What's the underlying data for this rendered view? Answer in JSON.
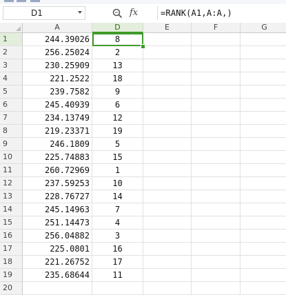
{
  "name_box": {
    "value": "D1"
  },
  "formula_bar": {
    "fx_label": "fx",
    "formula": "=RANK(A1,A:A,)"
  },
  "columns": [
    {
      "label": "A",
      "selected": false
    },
    {
      "label": "D",
      "selected": true
    },
    {
      "label": "E",
      "selected": false
    },
    {
      "label": "F",
      "selected": false
    },
    {
      "label": "G",
      "selected": false
    }
  ],
  "rows": [
    {
      "num": "1",
      "a": "244.39026",
      "d": "8"
    },
    {
      "num": "2",
      "a": "256.25024",
      "d": "2"
    },
    {
      "num": "3",
      "a": "230.25909",
      "d": "13"
    },
    {
      "num": "4",
      "a": "221.2522",
      "d": "18"
    },
    {
      "num": "5",
      "a": "239.7582",
      "d": "9"
    },
    {
      "num": "6",
      "a": "245.40939",
      "d": "6"
    },
    {
      "num": "7",
      "a": "234.13749",
      "d": "12"
    },
    {
      "num": "8",
      "a": "219.23371",
      "d": "19"
    },
    {
      "num": "9",
      "a": "246.1809",
      "d": "5"
    },
    {
      "num": "10",
      "a": "225.74883",
      "d": "15"
    },
    {
      "num": "11",
      "a": "260.72969",
      "d": "1"
    },
    {
      "num": "12",
      "a": "237.59253",
      "d": "10"
    },
    {
      "num": "13",
      "a": "228.76727",
      "d": "14"
    },
    {
      "num": "14",
      "a": "245.14963",
      "d": "7"
    },
    {
      "num": "15",
      "a": "251.14473",
      "d": "4"
    },
    {
      "num": "16",
      "a": "256.04882",
      "d": "3"
    },
    {
      "num": "17",
      "a": "225.0801",
      "d": "16"
    },
    {
      "num": "18",
      "a": "221.26752",
      "d": "17"
    },
    {
      "num": "19",
      "a": "235.68644",
      "d": "11"
    },
    {
      "num": "20",
      "a": "",
      "d": ""
    }
  ],
  "selected_row": "1",
  "colors": {
    "selection_accent": "#3f9a2a",
    "header_bg": "#f2f2f2"
  }
}
